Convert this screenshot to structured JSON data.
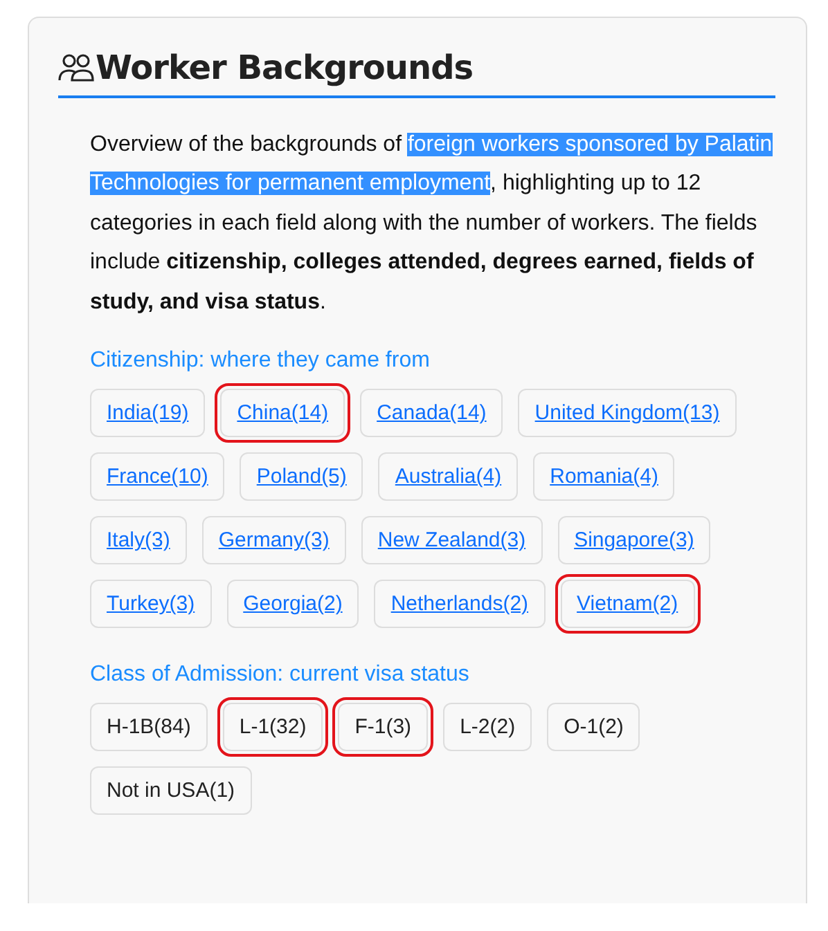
{
  "card": {
    "title": "Worker Backgrounds",
    "description": [
      {
        "text": "Overview of the backgrounds of ",
        "highlighted": false
      },
      {
        "text": "foreign workers sponsored by Palatin Technologies for permanent employment",
        "highlighted": true
      },
      {
        "text": ", highlighting up to 12 categories in each field along with the number of workers. The fields include **citizenship, colleges attended, degrees earned, fields of study, and visa status**.",
        "highlighted": false
      }
    ],
    "sections": [
      {
        "title": "Citizenship: where they came from",
        "kind": "links",
        "tags": [
          {
            "label": "India(19)",
            "circled": false
          },
          {
            "label": "China(14)",
            "circled": true
          },
          {
            "label": "Canada(14)",
            "circled": false
          },
          {
            "label": "United Kingdom(13)",
            "circled": false
          },
          {
            "label": "France(10)",
            "circled": false
          },
          {
            "label": "Poland(5)",
            "circled": false
          },
          {
            "label": "Australia(4)",
            "circled": false
          },
          {
            "label": "Romania(4)",
            "circled": false
          },
          {
            "label": "Italy(3)",
            "circled": false
          },
          {
            "label": "Germany(3)",
            "circled": false
          },
          {
            "label": "New Zealand(3)",
            "circled": false
          },
          {
            "label": "Singapore(3)",
            "circled": false
          },
          {
            "label": "Turkey(3)",
            "circled": false
          },
          {
            "label": "Georgia(2)",
            "circled": false
          },
          {
            "label": "Netherlands(2)",
            "circled": false
          },
          {
            "label": "Vietnam(2)",
            "circled": true
          }
        ]
      },
      {
        "title": "Class of Admission: current visa status",
        "kind": "plain",
        "tags": [
          {
            "label": "H-1B(84)",
            "circled": false
          },
          {
            "label": "L-1(32)",
            "circled": true
          },
          {
            "label": "F-1(3)",
            "circled": true
          },
          {
            "label": "L-2(2)",
            "circled": false
          },
          {
            "label": "O-1(2)",
            "circled": false
          },
          {
            "label": "Not in USA(1)",
            "circled": false
          }
        ]
      }
    ]
  }
}
